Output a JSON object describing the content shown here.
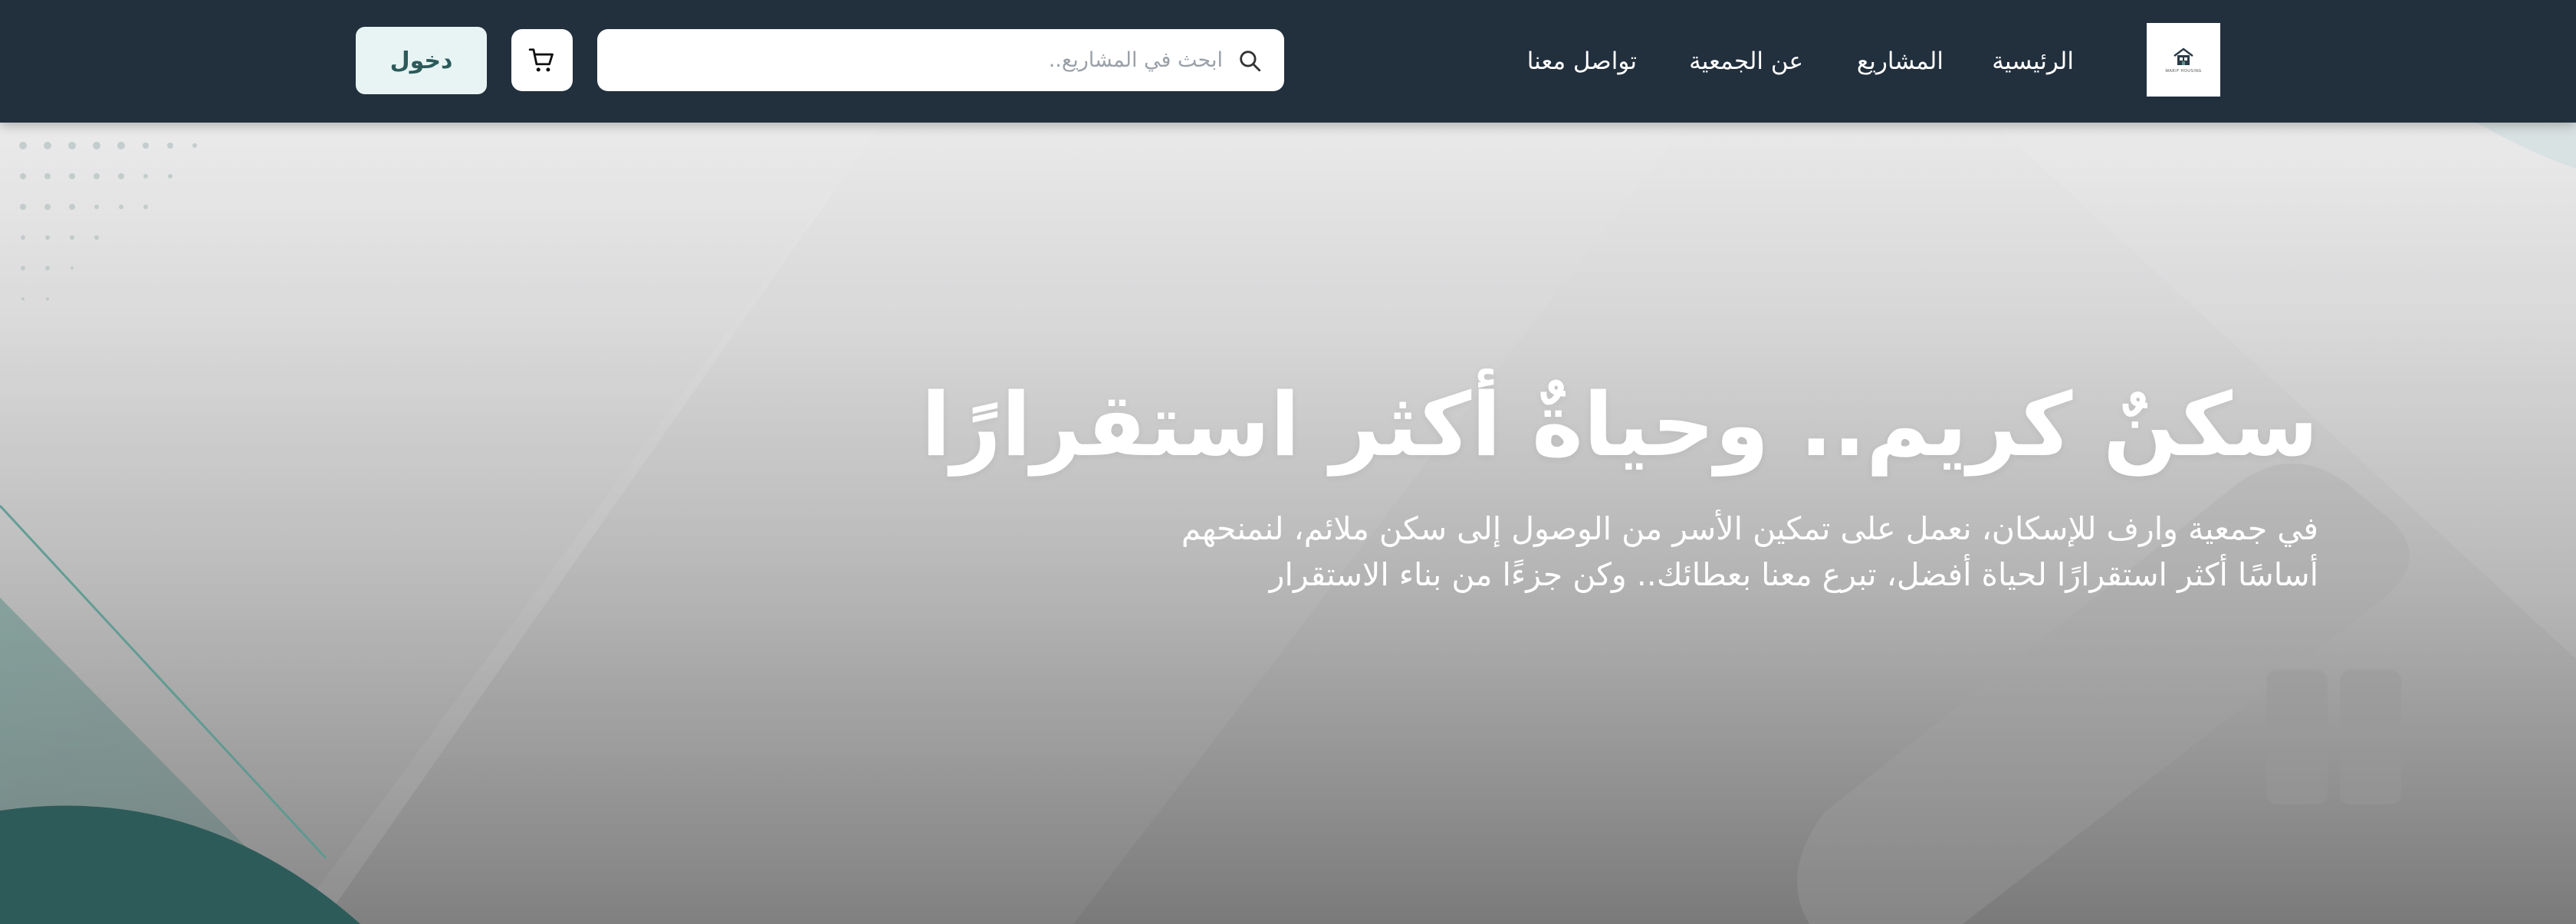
{
  "header": {
    "logo_caption": "WARIF HOUSING",
    "nav": {
      "home": "الرئيسية",
      "projects": "المشاريع",
      "about": "عن الجمعية",
      "contact": "تواصل معنا"
    },
    "search": {
      "placeholder": "ابحث في المشاريع.."
    },
    "login_label": "دخول"
  },
  "hero": {
    "title": "سكنٌ كريم.. وحياةٌ أكثر استقرارًا",
    "subtitle": "في جمعية وارف للإسكان، نعمل على تمكين الأسر من الوصول إلى سكن ملائم، لنمنحهم أساسًا أكثر استقرارًا لحياة أفضل، تبرع معنا بعطائك.. وكن جزءًا من بناء الاستقرار"
  },
  "colors": {
    "header_bg": "#222f3d",
    "accent_teal": "#2c5a5b",
    "login_bg": "#e8f4f4"
  },
  "icons": {
    "logo": "house-logo-icon",
    "search": "search-icon",
    "cart": "cart-icon"
  }
}
